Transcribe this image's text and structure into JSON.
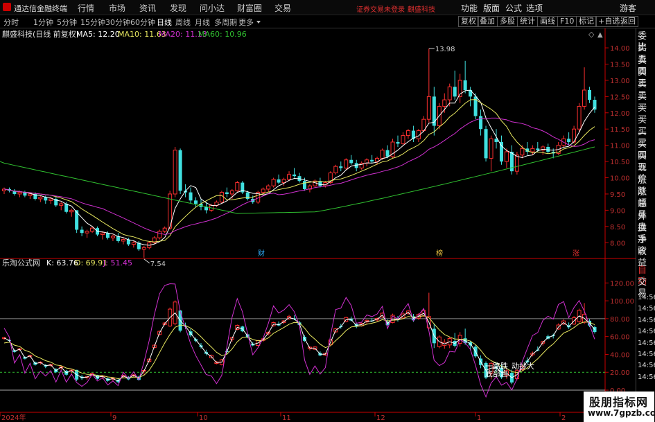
{
  "menubar": {
    "app_title": "通达信金融终端",
    "menus": [
      "行情",
      "市场",
      "资讯",
      "发现",
      "问小达",
      "财富圈",
      "交易"
    ],
    "notice": "证券交易未登录",
    "stock_name": "麒盛科技",
    "right_menus": [
      "功能",
      "版面",
      "公式",
      "选项"
    ],
    "guest": "游客"
  },
  "periodbar": {
    "periods": [
      "分时",
      "1分钟",
      "5分钟",
      "15分钟",
      "30分钟",
      "60分钟",
      "日线",
      "周线",
      "月线",
      "多周期",
      "更多"
    ],
    "active": "日线",
    "tools": [
      "复权",
      "叠加",
      "多股",
      "统计",
      "画线",
      "F10",
      "标记",
      "+自选",
      "返回"
    ]
  },
  "main_chart": {
    "title": "麒盛科技(日线 前复权)",
    "ma_labels": [
      {
        "text": "MA5: 12.20",
        "color": "#ffffff"
      },
      {
        "text": "MA10: 11.63",
        "color": "#e8e860"
      },
      {
        "text": "MA20: 11.13",
        "color": "#d030d0"
      },
      {
        "text": "MA60: 10.96",
        "color": "#30c030"
      }
    ],
    "ylim": [
      7.6,
      14.3
    ],
    "y_ticks": [
      "14.00",
      "13.50",
      "13.00",
      "12.50",
      "12.00",
      "11.50",
      "11.00",
      "10.50",
      "10.00",
      "9.50",
      "9.00",
      "8.50",
      "8.00"
    ],
    "high_label": "13.98",
    "low_label": "7.54",
    "markers": [
      "财",
      "榜",
      "涨"
    ]
  },
  "sub_chart": {
    "title": "乐淘公式网",
    "labels": [
      {
        "text": "K: 63.76",
        "color": "#ffffff"
      },
      {
        "text": "D: 69.91",
        "color": "#e8e860"
      },
      {
        "text": "J: 51.45",
        "color": "#d030d0"
      }
    ],
    "ylim": [
      0,
      135
    ],
    "y_ticks": [
      "120.00",
      "100.00",
      "80.00",
      "60.00",
      "40.00",
      "20.00",
      "0.00"
    ],
    "annotations": [
      "一路跌",
      "底部启",
      "动抄",
      "大"
    ]
  },
  "x_axis": {
    "labels": [
      "2024年",
      "9",
      "10",
      "11",
      "12",
      "1",
      "2"
    ]
  },
  "right_panel": {
    "items": [
      "委比",
      "卖五",
      "卖四",
      "卖三",
      "卖二",
      "卖一",
      "买一",
      "买二",
      "买三",
      "买四",
      "买五",
      "现价",
      "涨跌",
      "涨幅",
      "总量",
      "外盘",
      "换手",
      "净资",
      "收益",
      "自动",
      "交易",
      "14:56",
      "14:56",
      "14:56",
      "14:56",
      "14:56",
      "14:56",
      "14:56",
      "14:56"
    ]
  },
  "watermark": {
    "line1": "股朋指标网",
    "line2": "www.7gpzb.com"
  },
  "chart_data": {
    "type": "candlestick",
    "candles": [
      [
        9.6,
        9.7,
        9.5,
        9.65
      ],
      [
        9.65,
        9.7,
        9.55,
        9.6
      ],
      [
        9.6,
        9.65,
        9.45,
        9.5
      ],
      [
        9.5,
        9.6,
        9.4,
        9.55
      ],
      [
        9.55,
        9.6,
        9.4,
        9.45
      ],
      [
        9.45,
        9.55,
        9.35,
        9.5
      ],
      [
        9.5,
        9.55,
        9.3,
        9.35
      ],
      [
        9.35,
        9.45,
        9.25,
        9.4
      ],
      [
        9.4,
        9.45,
        9.2,
        9.3
      ],
      [
        9.3,
        9.4,
        9.2,
        9.35
      ],
      [
        9.35,
        9.4,
        9.1,
        9.15
      ],
      [
        9.15,
        9.25,
        9.0,
        9.2
      ],
      [
        9.2,
        9.25,
        8.9,
        8.95
      ],
      [
        8.95,
        9.05,
        8.8,
        9.0
      ],
      [
        9.0,
        9.0,
        8.3,
        8.4
      ],
      [
        8.4,
        8.5,
        8.2,
        8.3
      ],
      [
        8.3,
        8.4,
        8.15,
        8.35
      ],
      [
        8.35,
        8.5,
        8.3,
        8.45
      ],
      [
        8.45,
        8.5,
        8.2,
        8.25
      ],
      [
        8.25,
        8.35,
        8.1,
        8.3
      ],
      [
        8.3,
        8.35,
        8.1,
        8.15
      ],
      [
        8.15,
        8.25,
        8.05,
        8.2
      ],
      [
        8.2,
        8.3,
        8.0,
        8.05
      ],
      [
        8.05,
        8.15,
        7.95,
        8.1
      ],
      [
        8.1,
        8.15,
        7.9,
        7.95
      ],
      [
        7.95,
        8.05,
        7.85,
        8.0
      ],
      [
        8.0,
        8.05,
        7.75,
        7.8
      ],
      [
        7.8,
        7.9,
        7.54,
        7.85
      ],
      [
        7.85,
        8.05,
        7.8,
        8.0
      ],
      [
        8.0,
        8.2,
        7.95,
        8.15
      ],
      [
        8.15,
        8.4,
        8.1,
        8.35
      ],
      [
        8.35,
        8.5,
        8.3,
        8.45
      ],
      [
        8.45,
        9.6,
        8.4,
        9.5
      ],
      [
        9.5,
        10.95,
        9.4,
        10.85
      ],
      [
        10.85,
        10.9,
        9.5,
        9.6
      ],
      [
        9.6,
        9.8,
        9.4,
        9.55
      ],
      [
        9.55,
        9.7,
        9.2,
        9.3
      ],
      [
        9.3,
        9.4,
        9.1,
        9.2
      ],
      [
        9.2,
        9.35,
        9.0,
        9.1
      ],
      [
        9.1,
        9.25,
        8.9,
        9.0
      ],
      [
        9.0,
        9.2,
        8.95,
        9.15
      ],
      [
        9.15,
        9.3,
        9.1,
        9.25
      ],
      [
        9.25,
        9.6,
        9.2,
        9.55
      ],
      [
        9.55,
        9.7,
        9.4,
        9.5
      ],
      [
        9.5,
        9.65,
        9.35,
        9.6
      ],
      [
        9.6,
        9.9,
        9.55,
        9.85
      ],
      [
        9.85,
        9.9,
        9.5,
        9.55
      ],
      [
        9.55,
        9.6,
        9.3,
        9.35
      ],
      [
        9.35,
        9.45,
        9.2,
        9.25
      ],
      [
        9.25,
        9.6,
        9.2,
        9.55
      ],
      [
        9.55,
        9.7,
        9.45,
        9.65
      ],
      [
        9.65,
        9.8,
        9.55,
        9.75
      ],
      [
        9.75,
        10.0,
        9.7,
        9.95
      ],
      [
        9.95,
        10.1,
        9.8,
        9.85
      ],
      [
        9.85,
        10.0,
        9.75,
        9.95
      ],
      [
        9.95,
        10.2,
        9.9,
        10.1
      ],
      [
        10.1,
        10.3,
        10.0,
        10.05
      ],
      [
        10.05,
        10.15,
        9.85,
        9.9
      ],
      [
        9.9,
        10.0,
        9.6,
        9.65
      ],
      [
        9.65,
        9.8,
        9.55,
        9.75
      ],
      [
        9.75,
        9.95,
        9.7,
        9.9
      ],
      [
        9.9,
        10.0,
        9.7,
        9.75
      ],
      [
        9.75,
        9.9,
        9.7,
        9.85
      ],
      [
        9.85,
        10.2,
        9.8,
        10.15
      ],
      [
        10.15,
        10.4,
        10.1,
        10.35
      ],
      [
        10.35,
        10.5,
        10.2,
        10.3
      ],
      [
        10.3,
        10.6,
        10.25,
        10.55
      ],
      [
        10.55,
        10.7,
        10.4,
        10.45
      ],
      [
        10.45,
        10.55,
        10.2,
        10.3
      ],
      [
        10.3,
        10.5,
        10.25,
        10.45
      ],
      [
        10.45,
        10.6,
        10.35,
        10.55
      ],
      [
        10.55,
        10.7,
        10.45,
        10.5
      ],
      [
        10.5,
        10.65,
        10.4,
        10.6
      ],
      [
        10.6,
        10.9,
        10.55,
        10.85
      ],
      [
        10.85,
        11.0,
        10.6,
        10.65
      ],
      [
        10.65,
        11.2,
        10.6,
        11.1
      ],
      [
        11.1,
        11.3,
        10.95,
        11.05
      ],
      [
        11.05,
        11.4,
        11.0,
        11.3
      ],
      [
        11.3,
        11.5,
        11.2,
        11.45
      ],
      [
        11.45,
        11.6,
        11.1,
        11.2
      ],
      [
        11.2,
        11.5,
        11.1,
        11.45
      ],
      [
        11.45,
        11.9,
        11.4,
        11.8
      ],
      [
        11.8,
        13.98,
        11.7,
        12.5
      ],
      [
        12.5,
        12.8,
        11.3,
        11.6
      ],
      [
        11.6,
        12.3,
        11.5,
        12.2
      ],
      [
        12.2,
        12.6,
        12.0,
        12.4
      ],
      [
        12.4,
        12.9,
        12.2,
        12.8
      ],
      [
        12.8,
        13.3,
        12.4,
        12.5
      ],
      [
        12.5,
        13.2,
        12.3,
        13.0
      ],
      [
        13.0,
        13.6,
        12.6,
        12.7
      ],
      [
        12.7,
        12.8,
        12.2,
        12.5
      ],
      [
        12.5,
        12.6,
        11.8,
        11.9
      ],
      [
        11.9,
        12.1,
        11.3,
        11.5
      ],
      [
        11.5,
        11.6,
        10.5,
        10.6
      ],
      [
        10.6,
        11.3,
        10.2,
        11.2
      ],
      [
        11.2,
        11.5,
        10.9,
        11.1
      ],
      [
        11.1,
        11.3,
        10.4,
        10.5
      ],
      [
        10.5,
        10.9,
        10.3,
        10.8
      ],
      [
        10.8,
        11.0,
        10.1,
        10.2
      ],
      [
        10.2,
        10.8,
        10.1,
        10.7
      ],
      [
        10.7,
        11.0,
        10.6,
        10.9
      ],
      [
        10.9,
        11.1,
        10.7,
        10.8
      ],
      [
        10.8,
        11.0,
        10.7,
        10.9
      ],
      [
        10.9,
        11.1,
        10.8,
        10.85
      ],
      [
        10.85,
        11.0,
        10.7,
        10.95
      ],
      [
        10.95,
        11.05,
        10.75,
        10.8
      ],
      [
        10.8,
        10.9,
        10.6,
        10.75
      ],
      [
        10.75,
        11.1,
        10.7,
        11.0
      ],
      [
        11.0,
        11.3,
        10.95,
        11.2
      ],
      [
        11.2,
        11.4,
        11.0,
        11.1
      ],
      [
        11.1,
        11.6,
        11.05,
        11.5
      ],
      [
        11.5,
        12.3,
        11.4,
        12.2
      ],
      [
        12.2,
        13.4,
        12.1,
        12.7
      ],
      [
        12.7,
        12.8,
        12.3,
        12.4
      ],
      [
        12.4,
        12.5,
        12.0,
        12.1
      ]
    ]
  }
}
